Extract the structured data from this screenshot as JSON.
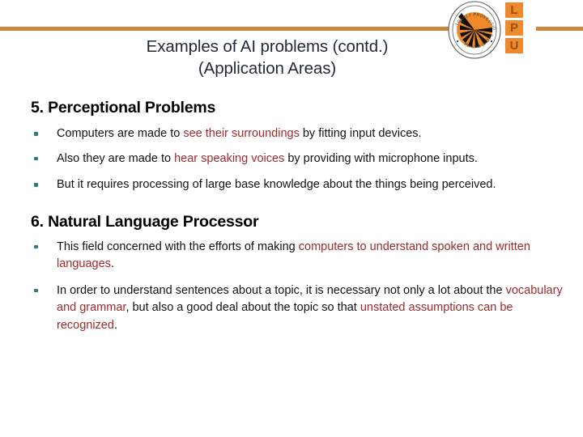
{
  "slide": {
    "title_line1": "Examples of AI problems (contd.)",
    "title_line2": "(Application Areas)",
    "accent_orange": "#c8853c",
    "highlight_red": "#9e2a2a",
    "bullet_teal": "#2c7d79",
    "title_color": "#1f2a33"
  },
  "logo": {
    "name": "lpu-logo",
    "seal_text_top": "LOVELY PROFESSIONAL UNIVERSITY",
    "seal_text_bottom": "PUNJAB (INDIA)",
    "letters": [
      "L",
      "P",
      "U"
    ]
  },
  "sections": [
    {
      "heading": "5. Perceptional Problems",
      "bullets": [
        {
          "parts": [
            {
              "text": "Computers are made to ",
              "highlight": false
            },
            {
              "text": "see their surroundings",
              "highlight": true
            },
            {
              "text": " by fitting input devices.",
              "highlight": false
            }
          ]
        },
        {
          "justified": true,
          "parts": [
            {
              "text": " Also they are made to ",
              "highlight": false
            },
            {
              "text": "hear speaking voices",
              "highlight": true
            },
            {
              "text": "  by providing with microphone inputs.",
              "highlight": false
            }
          ]
        },
        {
          "parts": [
            {
              "text": " But it requires  processing of large base knowledge about the things being perceived.",
              "highlight": false
            }
          ]
        }
      ]
    },
    {
      "heading": "6. Natural Language Processor",
      "bullets": [
        {
          "parts": [
            {
              "text": "This field concerned with the efforts of making ",
              "highlight": false
            },
            {
              "text": "computers to understand spoken and written languages",
              "highlight": true
            },
            {
              "text": ".",
              "highlight": false
            }
          ]
        },
        {
          "parts": [
            {
              "text": "In order to understand sentences about a topic, it is necessary not only a lot about  the ",
              "highlight": false
            },
            {
              "text": "vocabulary and grammar",
              "highlight": true
            },
            {
              "text": ", but also a good deal about the topic so that ",
              "highlight": false
            },
            {
              "text": "unstated assumptions  can be recognized",
              "highlight": true
            },
            {
              "text": ".",
              "highlight": false
            }
          ]
        }
      ]
    }
  ]
}
